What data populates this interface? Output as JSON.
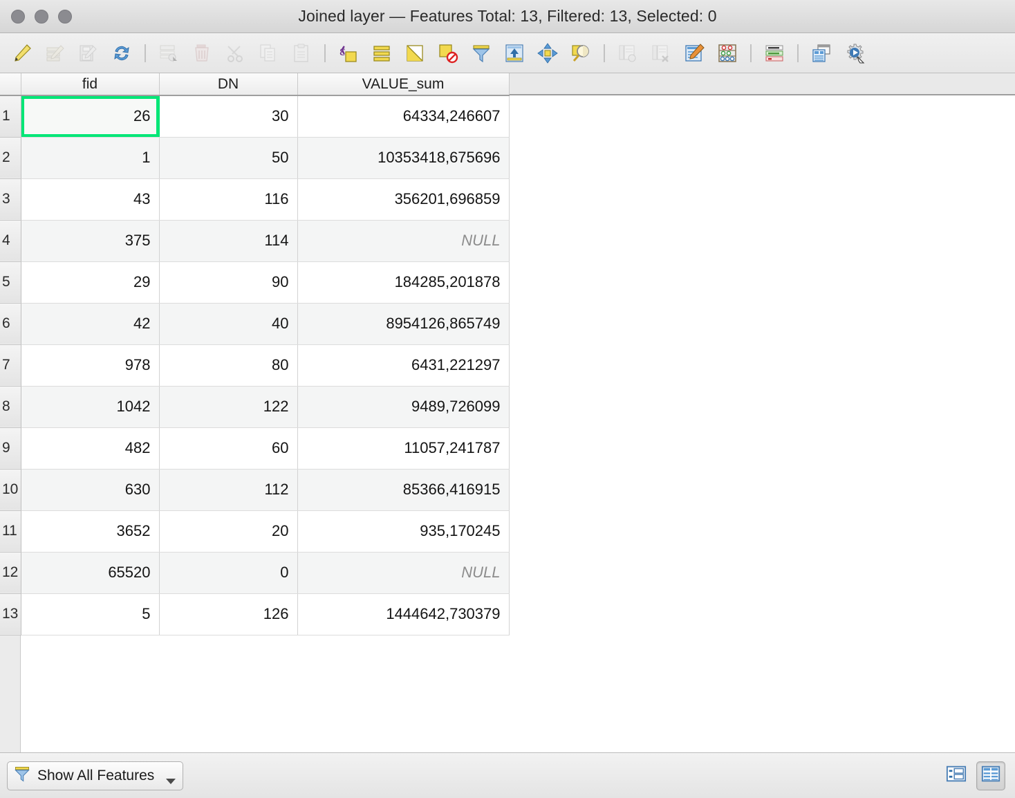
{
  "window": {
    "title": "Joined layer — Features Total: 13, Filtered: 13, Selected: 0",
    "layer_name": "Joined layer",
    "features_total": 13,
    "features_filtered": 13,
    "features_selected": 0
  },
  "colors": {
    "selection_outline": "#00e676",
    "toolbar_yellow": "#e8c84a",
    "toolbar_blue": "#4a86c8",
    "titlebar": "#dedede",
    "row_alt": "#f4f5f5"
  },
  "toolbar": {
    "groups": [
      {
        "buttons": [
          {
            "name": "toggle-editing-icon",
            "tooltip": "Toggle editing mode",
            "enabled": true
          },
          {
            "name": "edit-table-icon",
            "tooltip": "Toggle multi edit mode",
            "enabled": false
          },
          {
            "name": "save-edits-icon",
            "tooltip": "Save edits",
            "enabled": false
          },
          {
            "name": "reload-table-icon",
            "tooltip": "Reload the table",
            "enabled": true
          }
        ]
      },
      {
        "buttons": [
          {
            "name": "add-feature-icon",
            "tooltip": "Add feature",
            "enabled": false
          },
          {
            "name": "delete-selected-icon",
            "tooltip": "Delete selected features",
            "enabled": false
          },
          {
            "name": "cut-features-icon",
            "tooltip": "Cut selected features",
            "enabled": false
          },
          {
            "name": "copy-features-icon",
            "tooltip": "Copy selected features",
            "enabled": false
          },
          {
            "name": "paste-features-icon",
            "tooltip": "Paste features",
            "enabled": false
          }
        ]
      },
      {
        "buttons": [
          {
            "name": "select-by-expression-icon",
            "tooltip": "Select features using an expression",
            "enabled": true
          },
          {
            "name": "select-all-icon",
            "tooltip": "Select all features",
            "enabled": true
          },
          {
            "name": "invert-selection-icon",
            "tooltip": "Invert selection",
            "enabled": true
          },
          {
            "name": "deselect-all-icon",
            "tooltip": "Deselect all features",
            "enabled": true
          },
          {
            "name": "filter-expression-icon",
            "tooltip": "Filter features using form",
            "enabled": true
          },
          {
            "name": "move-selection-to-top-icon",
            "tooltip": "Move selection to top",
            "enabled": true
          },
          {
            "name": "pan-to-selection-icon",
            "tooltip": "Pan map to the selected rows",
            "enabled": true
          },
          {
            "name": "zoom-to-selection-icon",
            "tooltip": "Zoom map to the selected rows",
            "enabled": true
          }
        ]
      },
      {
        "buttons": [
          {
            "name": "new-field-icon",
            "tooltip": "New field",
            "enabled": false
          },
          {
            "name": "delete-field-icon",
            "tooltip": "Delete field",
            "enabled": false
          },
          {
            "name": "field-calculator-icon",
            "tooltip": "Open field calculator",
            "enabled": true
          },
          {
            "name": "statistical-summary-icon",
            "tooltip": "Statistical summary",
            "enabled": true
          }
        ]
      },
      {
        "buttons": [
          {
            "name": "conditional-formatting-icon",
            "tooltip": "Conditional formatting",
            "enabled": true
          }
        ]
      },
      {
        "buttons": [
          {
            "name": "dock-table-icon",
            "tooltip": "Dock attribute table",
            "enabled": true
          },
          {
            "name": "actions-icon",
            "tooltip": "Actions",
            "enabled": true
          }
        ]
      }
    ]
  },
  "table": {
    "columns": [
      "fid",
      "DN",
      "VALUE_sum"
    ],
    "selected_cell": {
      "row": 1,
      "column": "fid"
    },
    "rows": [
      {
        "n": "1",
        "fid": "26",
        "DN": "30",
        "VALUE_sum": "64334,246607",
        "null_value": false
      },
      {
        "n": "2",
        "fid": "1",
        "DN": "50",
        "VALUE_sum": "10353418,675696",
        "null_value": false
      },
      {
        "n": "3",
        "fid": "43",
        "DN": "116",
        "VALUE_sum": "356201,696859",
        "null_value": false
      },
      {
        "n": "4",
        "fid": "375",
        "DN": "114",
        "VALUE_sum": "NULL",
        "null_value": true
      },
      {
        "n": "5",
        "fid": "29",
        "DN": "90",
        "VALUE_sum": "184285,201878",
        "null_value": false
      },
      {
        "n": "6",
        "fid": "42",
        "DN": "40",
        "VALUE_sum": "8954126,865749",
        "null_value": false
      },
      {
        "n": "7",
        "fid": "978",
        "DN": "80",
        "VALUE_sum": "6431,221297",
        "null_value": false
      },
      {
        "n": "8",
        "fid": "1042",
        "DN": "122",
        "VALUE_sum": "9489,726099",
        "null_value": false
      },
      {
        "n": "9",
        "fid": "482",
        "DN": "60",
        "VALUE_sum": "11057,241787",
        "null_value": false
      },
      {
        "n": "10",
        "fid": "630",
        "DN": "112",
        "VALUE_sum": "85366,416915",
        "null_value": false
      },
      {
        "n": "11",
        "fid": "3652",
        "DN": "20",
        "VALUE_sum": "935,170245",
        "null_value": false
      },
      {
        "n": "12",
        "fid": "65520",
        "DN": "0",
        "VALUE_sum": "NULL",
        "null_value": true
      },
      {
        "n": "13",
        "fid": "5",
        "DN": "126",
        "VALUE_sum": "1444642,730379",
        "null_value": false
      }
    ]
  },
  "statusbar": {
    "filter_label": "Show All Features",
    "filter_icon": "filter-funnel-icon",
    "view_form_icon": "form-view-icon",
    "view_table_icon": "table-view-icon",
    "active_view": "table"
  }
}
